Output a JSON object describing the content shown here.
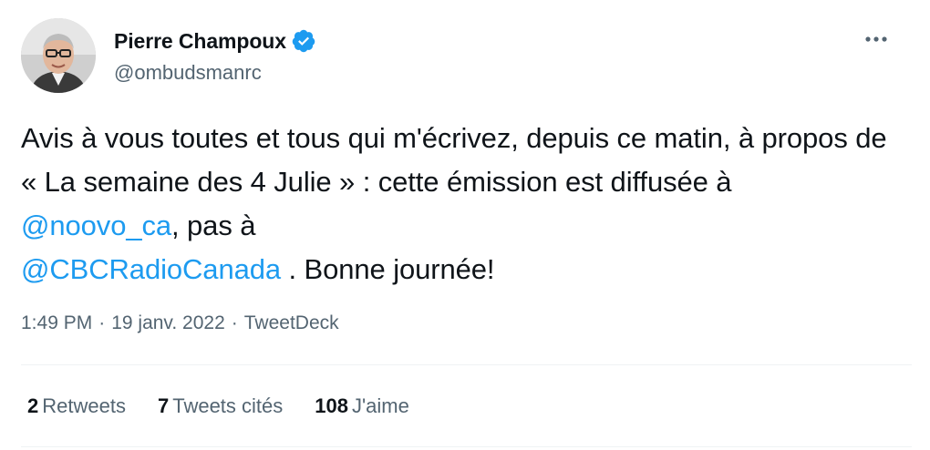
{
  "author": {
    "name": "Pierre Champoux",
    "handle": "@ombudsmanrc"
  },
  "tweet": {
    "text_1": "Avis à vous toutes et tous qui m'écrivez, depuis ce matin, à propos de « La semaine des 4 Julie » : cette émission est diffusée à ",
    "mention_1": "@noovo_ca",
    "text_2": ", pas à ",
    "mention_2": "@CBCRadioCanada",
    "text_3": " . Bonne journée!"
  },
  "meta": {
    "time": "1:49 PM",
    "separator": "·",
    "date": "19 janv. 2022",
    "source": "TweetDeck"
  },
  "stats": {
    "retweets_count": "2",
    "retweets_label": "Retweets",
    "quotes_count": "7",
    "quotes_label": "Tweets cités",
    "likes_count": "108",
    "likes_label": "J'aime"
  },
  "colors": {
    "accent": "#1d9bf0",
    "text_primary": "#0f1419",
    "text_secondary": "#536471",
    "divider": "#eff3f4"
  },
  "icons": {
    "verified": "verified-badge-icon",
    "more": "more-options-icon"
  }
}
